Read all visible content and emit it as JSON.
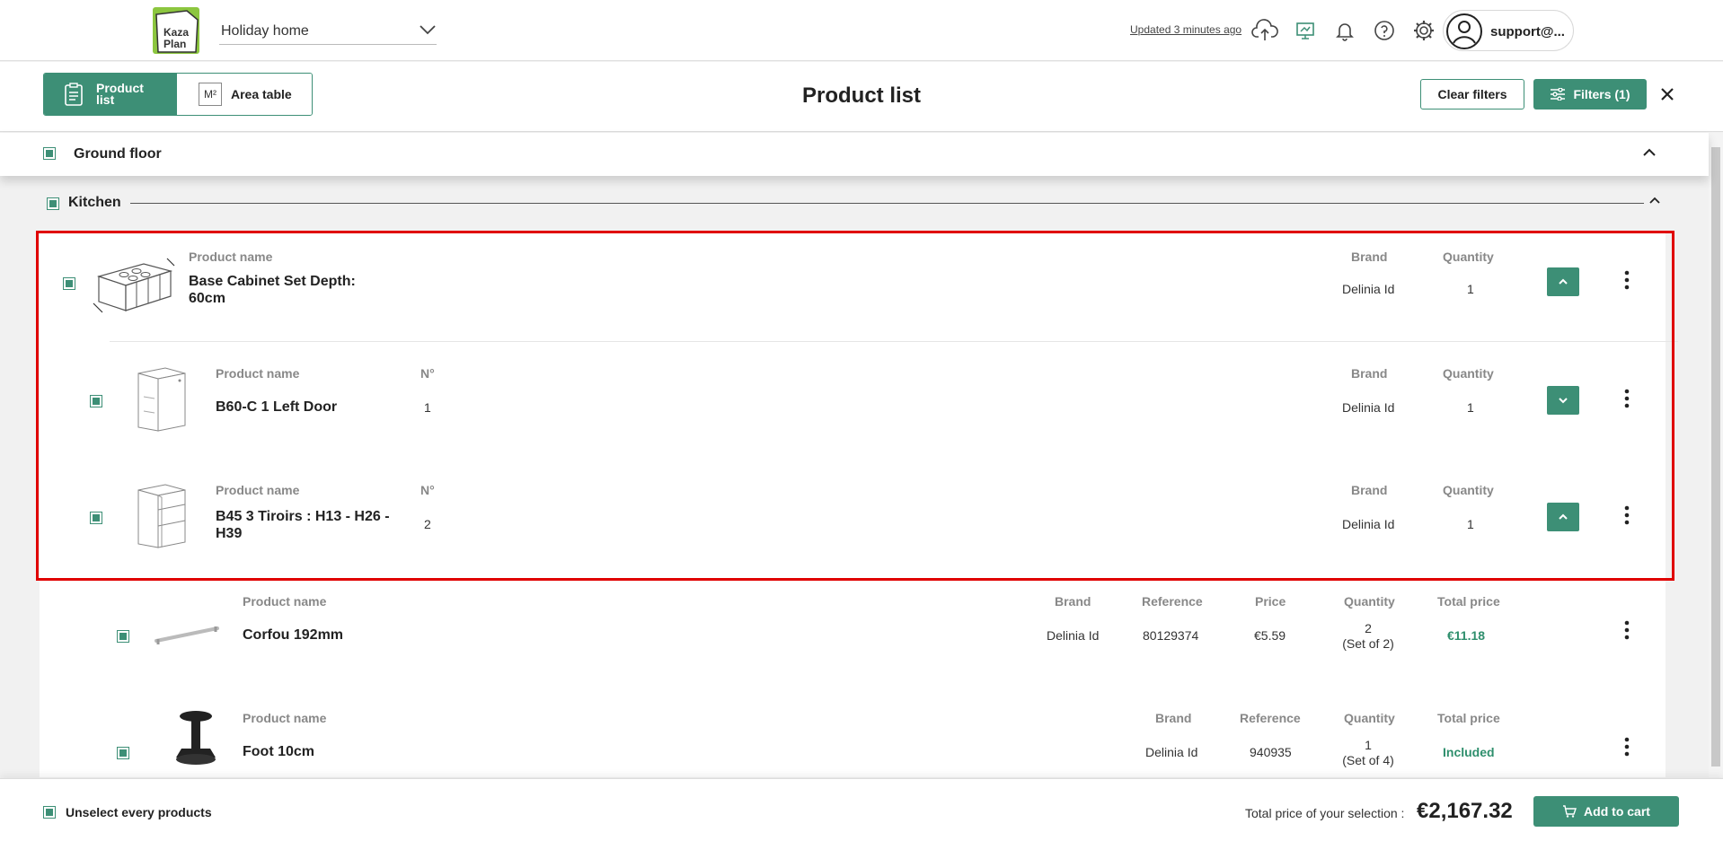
{
  "header": {
    "project": "Holiday home",
    "updated": "Updated 3 minutes ago",
    "user": "support@...",
    "icons": [
      "cloud-upload-icon",
      "screen-icon",
      "bell-icon",
      "help-icon",
      "gear-icon",
      "user-icon"
    ],
    "logo_line1": "Kaza",
    "logo_line2": "Plan"
  },
  "toolbar": {
    "product_list": "Product list",
    "area_table": "Area table",
    "m2": "M²",
    "title": "Product list",
    "clear_filters": "Clear filters",
    "filters": "Filters (1)"
  },
  "floor": {
    "label": "Ground floor"
  },
  "room": {
    "label": "Kitchen"
  },
  "products": [
    {
      "name": "Base Cabinet Set Depth: 60cm",
      "name_h": "Product name",
      "brand_h": "Brand",
      "qty_h": "Quantity",
      "brand": "Delinia Id",
      "qty": "1"
    },
    {
      "name": "B60-C 1 Left Door",
      "name_h": "Product name",
      "no_h": "N°",
      "no": "1",
      "brand_h": "Brand",
      "qty_h": "Quantity",
      "brand": "Delinia Id",
      "qty": "1"
    },
    {
      "name": "B45 3 Tiroirs : H13 - H26 - H39",
      "name_h": "Product name",
      "no_h": "N°",
      "no": "2",
      "brand_h": "Brand",
      "qty_h": "Quantity",
      "brand": "Delinia Id",
      "qty": "1"
    },
    {
      "name": "Corfou 192mm",
      "name_h": "Product name",
      "brand_h": "Brand",
      "ref_h": "Reference",
      "price_h": "Price",
      "qty_h": "Quantity",
      "total_h": "Total price",
      "brand": "Delinia Id",
      "ref": "80129374",
      "price": "€5.59",
      "qty": "2",
      "qty_note": "(Set of 2)",
      "total": "€11.18"
    },
    {
      "name": "Foot 10cm",
      "name_h": "Product name",
      "brand_h": "Brand",
      "ref_h": "Reference",
      "qty_h": "Quantity",
      "total_h": "Total price",
      "brand": "Delinia Id",
      "ref": "940935",
      "qty": "1",
      "qty_note": "(Set of 4)",
      "total": "Included"
    }
  ],
  "footer": {
    "unselect": "Unselect every products",
    "total_label": "Total price of your selection :",
    "total": "€2,167.32",
    "add_to_cart": "Add to cart"
  },
  "colors": {
    "accent": "#3d8f76",
    "highlight": "#e00000",
    "logo": "#8cc63f"
  }
}
